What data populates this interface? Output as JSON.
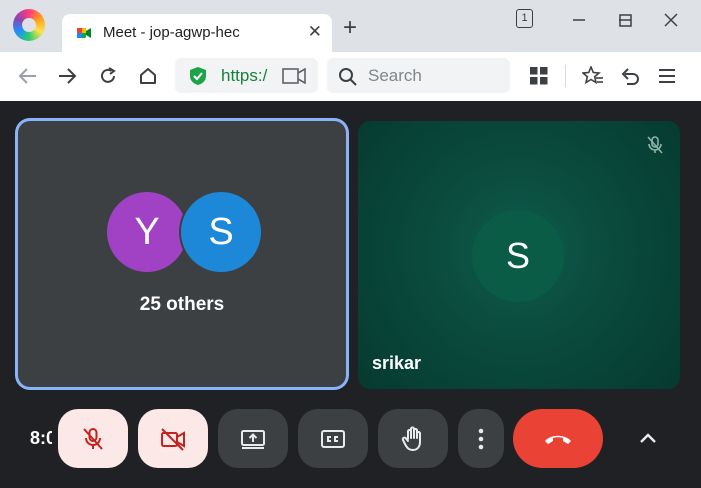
{
  "browser": {
    "tab": {
      "title": "Meet - jop-agwp-hec",
      "close_glyph": "✕"
    },
    "new_tab_glyph": "+",
    "tab_count": "1",
    "url_text": "https:/",
    "search_placeholder": "Search"
  },
  "meeting": {
    "others_tile": {
      "avatars": [
        {
          "initial": "Y",
          "color": "#a142c4"
        },
        {
          "initial": "S",
          "color": "#1e88d8"
        }
      ],
      "label": "25 others"
    },
    "participant_tile": {
      "initial": "S",
      "name": "srikar",
      "muted": true
    },
    "clock": "8:0",
    "controls": [
      {
        "name": "mic-button",
        "icon": "mic-off-icon",
        "state": "off"
      },
      {
        "name": "camera-button",
        "icon": "videocam-off-icon",
        "state": "off"
      },
      {
        "name": "present-button",
        "icon": "present-screen-icon"
      },
      {
        "name": "captions-button",
        "icon": "captions-icon"
      },
      {
        "name": "raise-hand-button",
        "icon": "hand-icon"
      },
      {
        "name": "more-options-button",
        "icon": "more-vert-icon"
      },
      {
        "name": "leave-call-button",
        "icon": "call-end-icon"
      }
    ],
    "colors": {
      "accent": "#8ab4f8",
      "end_call": "#ea4335",
      "tile_bg": "#3c4043",
      "muted_bg": "#fce8e6"
    }
  }
}
